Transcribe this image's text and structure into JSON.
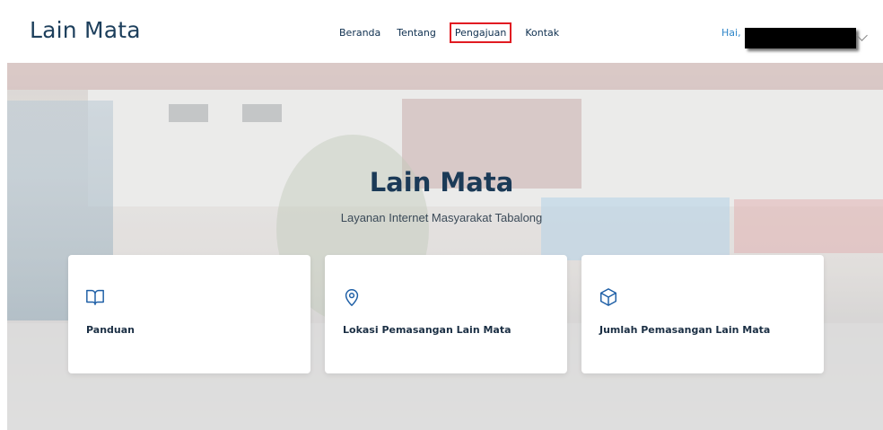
{
  "brand": {
    "name": "Lain Mata"
  },
  "nav": {
    "items": [
      {
        "label": "Beranda"
      },
      {
        "label": "Tentang"
      },
      {
        "label": "Pengajuan"
      },
      {
        "label": "Kontak"
      }
    ],
    "highlight_color": "#e11b22"
  },
  "user": {
    "greeting": "Hai, M"
  },
  "hero": {
    "title": "Lain Mata",
    "subtitle": "Layanan Internet Masyarakat Tabalong"
  },
  "cards": [
    {
      "label": "Panduan",
      "icon": "book-icon"
    },
    {
      "label": "Lokasi Pemasangan Lain Mata",
      "icon": "map-pin-icon"
    },
    {
      "label": "Jumlah Pemasangan Lain Mata",
      "icon": "box-icon"
    }
  ],
  "colors": {
    "accent": "#2f86c9",
    "brand_text": "#1d3f5c"
  }
}
